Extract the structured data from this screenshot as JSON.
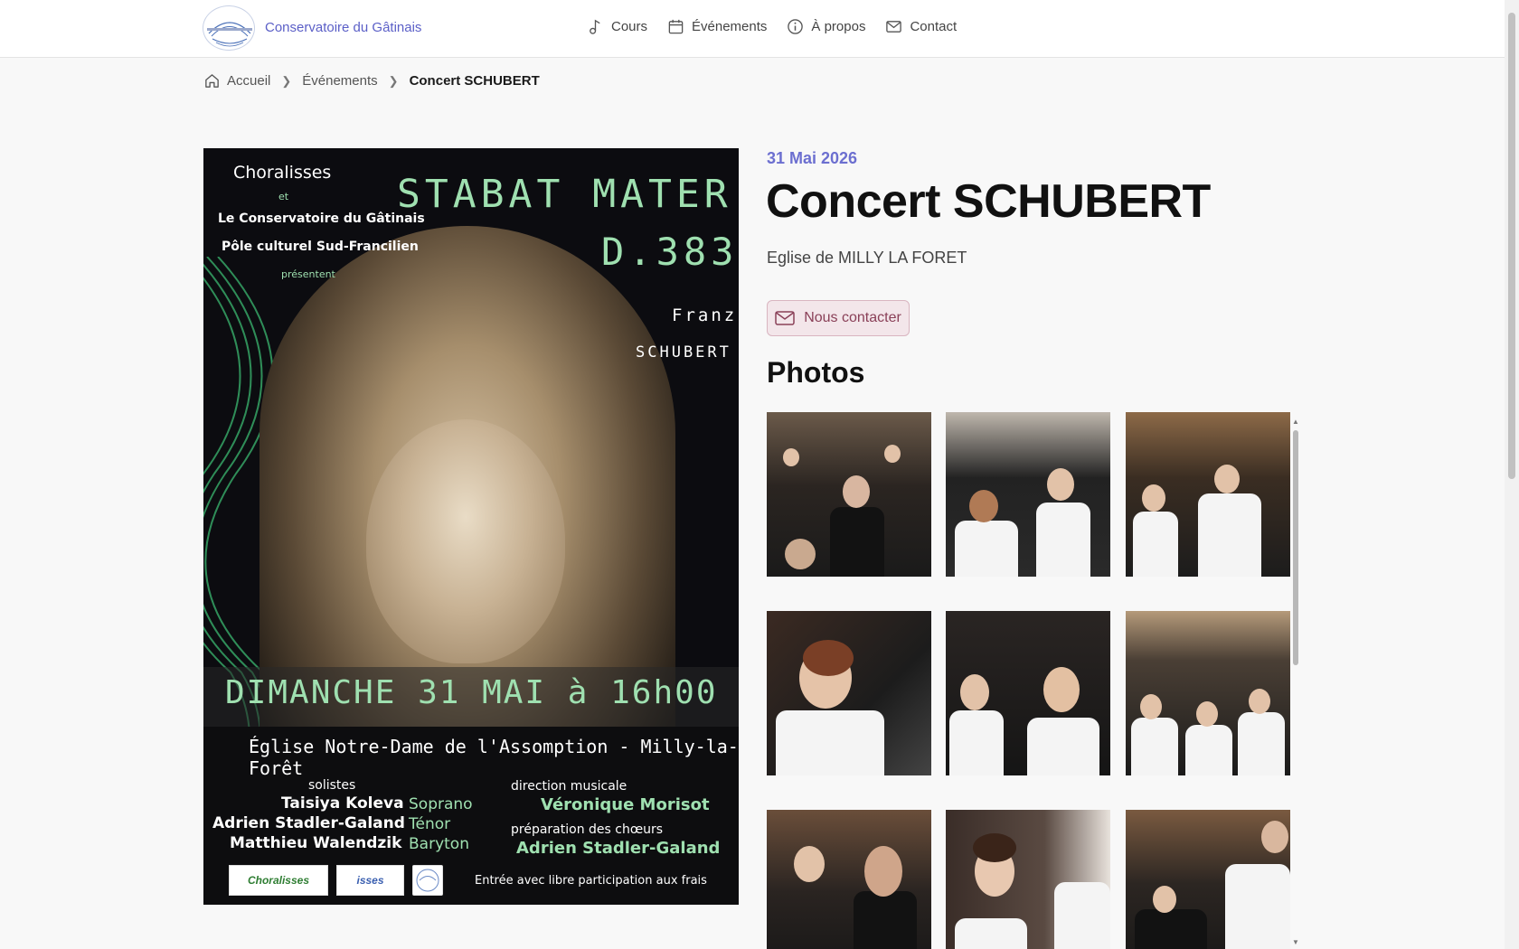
{
  "header": {
    "brand": "Conservatoire du Gâtinais",
    "nav": [
      {
        "label": "Cours",
        "icon": "music-note-icon"
      },
      {
        "label": "Événements",
        "icon": "calendar-icon"
      },
      {
        "label": "À propos",
        "icon": "info-icon"
      },
      {
        "label": "Contact",
        "icon": "mail-icon"
      }
    ]
  },
  "breadcrumb": {
    "home": "Accueil",
    "events": "Événements",
    "current": "Concert SCHUBERT"
  },
  "event": {
    "date": "31 Mai 2026",
    "title": "Concert SCHUBERT",
    "venue": "Eglise de MILLY LA FORET",
    "contact_button": "Nous contacter",
    "photos_heading": "Photos"
  },
  "poster": {
    "org1": "Choralisses",
    "et": "et",
    "org2": "Le Conservatoire du Gâtinais",
    "org3": "Pôle culturel Sud-Francilien",
    "presentent": "présentent",
    "work1": "STABAT MATER",
    "work2": "D.383",
    "composer1": "Franz",
    "composer2": "SCHUBERT",
    "date_line": "DIMANCHE 31 MAI à 16h00",
    "place_line": "Église Notre-Dame de l'Assomption - Milly-la-Forêt",
    "solistes_label": "solistes",
    "soloists": [
      {
        "name": "Taisiya Koleva",
        "voice": "Soprano"
      },
      {
        "name": "Adrien Stadler-Galand",
        "voice": "Ténor"
      },
      {
        "name": "Matthieu Walendzik",
        "voice": "Baryton"
      }
    ],
    "direction_label": "direction musicale",
    "director": "Véronique Morisot",
    "prep_label": "préparation des chœurs",
    "prep_name": "Adrien Stadler-Galand",
    "sponsor1": "Choralisses",
    "sponsor2": "isses",
    "entry": "Entrée avec libre participation aux frais"
  },
  "colors": {
    "accent": "#6c6fd0",
    "button_bg": "#f3e6ea",
    "button_text": "#8a4058"
  }
}
